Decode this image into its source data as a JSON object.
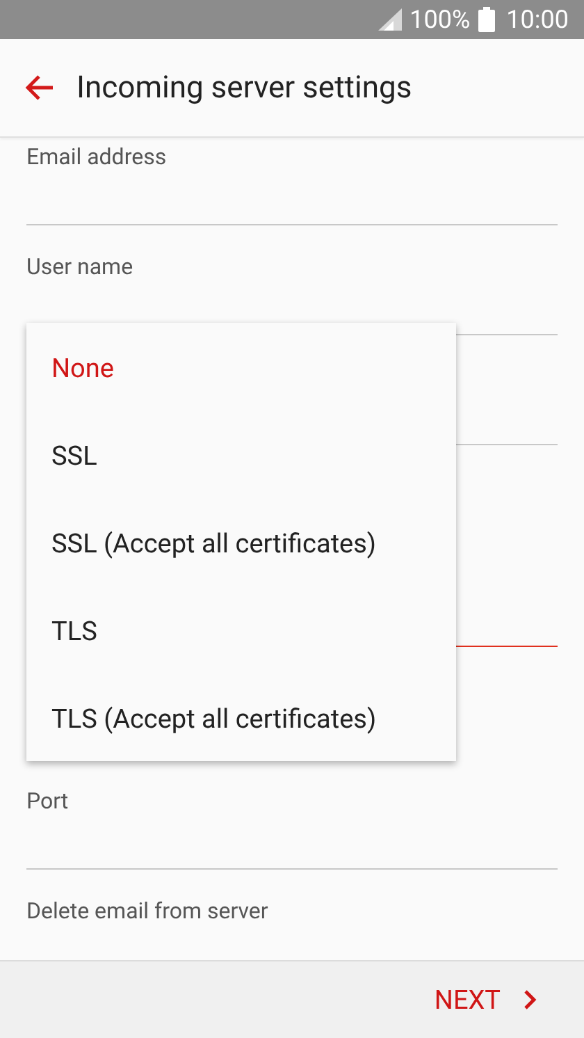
{
  "status_bar": {
    "battery": "100%",
    "time": "10:00"
  },
  "app_bar": {
    "title": "Incoming server settings"
  },
  "fields": [
    {
      "label": "Email address",
      "focused": false
    },
    {
      "label": "User name",
      "focused": false
    },
    {
      "focused": false
    },
    {
      "focused": true
    },
    {
      "label": "Port",
      "focused": false
    },
    {
      "label": "Delete email from server"
    }
  ],
  "menu": {
    "items": [
      {
        "label": "None",
        "selected": true
      },
      {
        "label": "SSL",
        "selected": false
      },
      {
        "label": "SSL (Accept all certificates)",
        "selected": false
      },
      {
        "label": "TLS",
        "selected": false
      },
      {
        "label": "TLS (Accept all certificates)",
        "selected": false
      }
    ]
  },
  "bottom_bar": {
    "next": "NEXT"
  }
}
